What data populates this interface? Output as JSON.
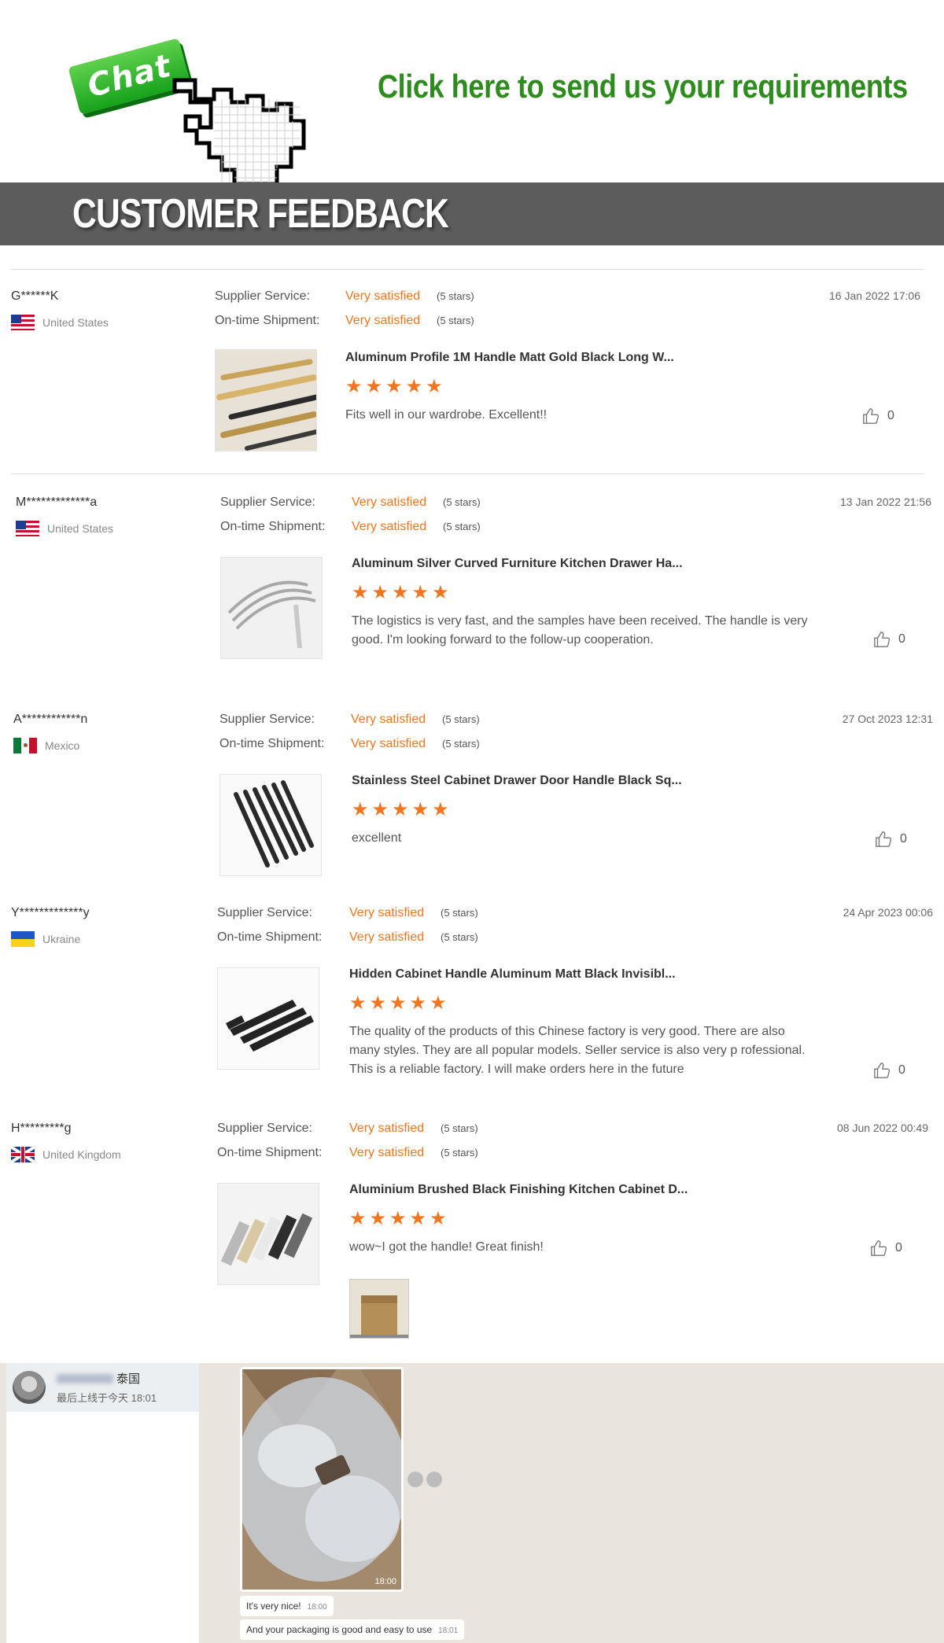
{
  "banner": {
    "chat_button": "Chat",
    "cta": "Click here to send us your requirements",
    "header": "CUSTOMER FEEDBACK",
    "accent_green": "#2e8b1e"
  },
  "labels": {
    "supplier_service": "Supplier Service:",
    "ontime_shipment": "On-time Shipment:"
  },
  "reviews": [
    {
      "name": "G******K",
      "country": "United States",
      "flag": "us",
      "service_rating": "Very satisfied",
      "service_stars": "(5 stars)",
      "shipment_rating": "Very satisfied",
      "shipment_stars": "(5 stars)",
      "date": "16 Jan 2022 17:06",
      "product": "Aluminum Profile 1M Handle Matt Gold Black Long W...",
      "stars": 5,
      "comment": "Fits well in our wardrobe. Excellent!!",
      "likes": "0"
    },
    {
      "name": "M*************a",
      "country": "United States",
      "flag": "us",
      "service_rating": "Very satisfied",
      "service_stars": "(5 stars)",
      "shipment_rating": "Very satisfied",
      "shipment_stars": "(5 stars)",
      "date": "13 Jan 2022 21:56",
      "product": "Aluminum Silver Curved Furniture Kitchen Drawer Ha...",
      "stars": 5,
      "comment": "The logistics is very fast, and the samples have been received. The handle is very good. I'm looking forward to the follow-up cooperation.",
      "likes": "0"
    },
    {
      "name": "A************n",
      "country": "Mexico",
      "flag": "mx",
      "service_rating": "Very satisfied",
      "service_stars": "(5 stars)",
      "shipment_rating": "Very satisfied",
      "shipment_stars": "(5 stars)",
      "date": "27 Oct 2023 12:31",
      "product": "Stainless Steel Cabinet Drawer Door Handle Black Sq...",
      "stars": 5,
      "comment": "excellent",
      "likes": "0"
    },
    {
      "name": "Y*************y",
      "country": "Ukraine",
      "flag": "ua",
      "service_rating": "Very satisfied",
      "service_stars": "(5 stars)",
      "shipment_rating": "Very satisfied",
      "shipment_stars": "(5 stars)",
      "date": "24 Apr 2023 00:06",
      "product": "Hidden Cabinet Handle Aluminum Matt Black Invisibl...",
      "stars": 5,
      "comment": "The quality of the products of this Chinese factory is very good. There are also many styles. They are all popular models. Seller service is also very p rofessional. This is a reliable factory. I will make orders here in the future",
      "likes": "0"
    },
    {
      "name": "H*********g",
      "country": "United Kingdom",
      "flag": "uk",
      "service_rating": "Very satisfied",
      "service_stars": "(5 stars)",
      "shipment_rating": "Very satisfied",
      "shipment_stars": "(5 stars)",
      "date": "08 Jun 2022 00:49",
      "product": "Aluminium Brushed Black Finishing Kitchen Cabinet D...",
      "stars": 5,
      "comment": "wow~I got the handle! Great finish!",
      "likes": "0"
    }
  ],
  "chat": {
    "contact_suffix": "泰国",
    "status": "最后上线于今天 18:01",
    "photo_time": "18:00",
    "messages": [
      {
        "text": "It's very nice!",
        "time": "18:00"
      },
      {
        "text": "And your packaging is good and easy to use",
        "time": "18:01"
      }
    ]
  },
  "colors": {
    "rating_orange": "#f2761f",
    "header_bg": "#5c5c5c"
  }
}
